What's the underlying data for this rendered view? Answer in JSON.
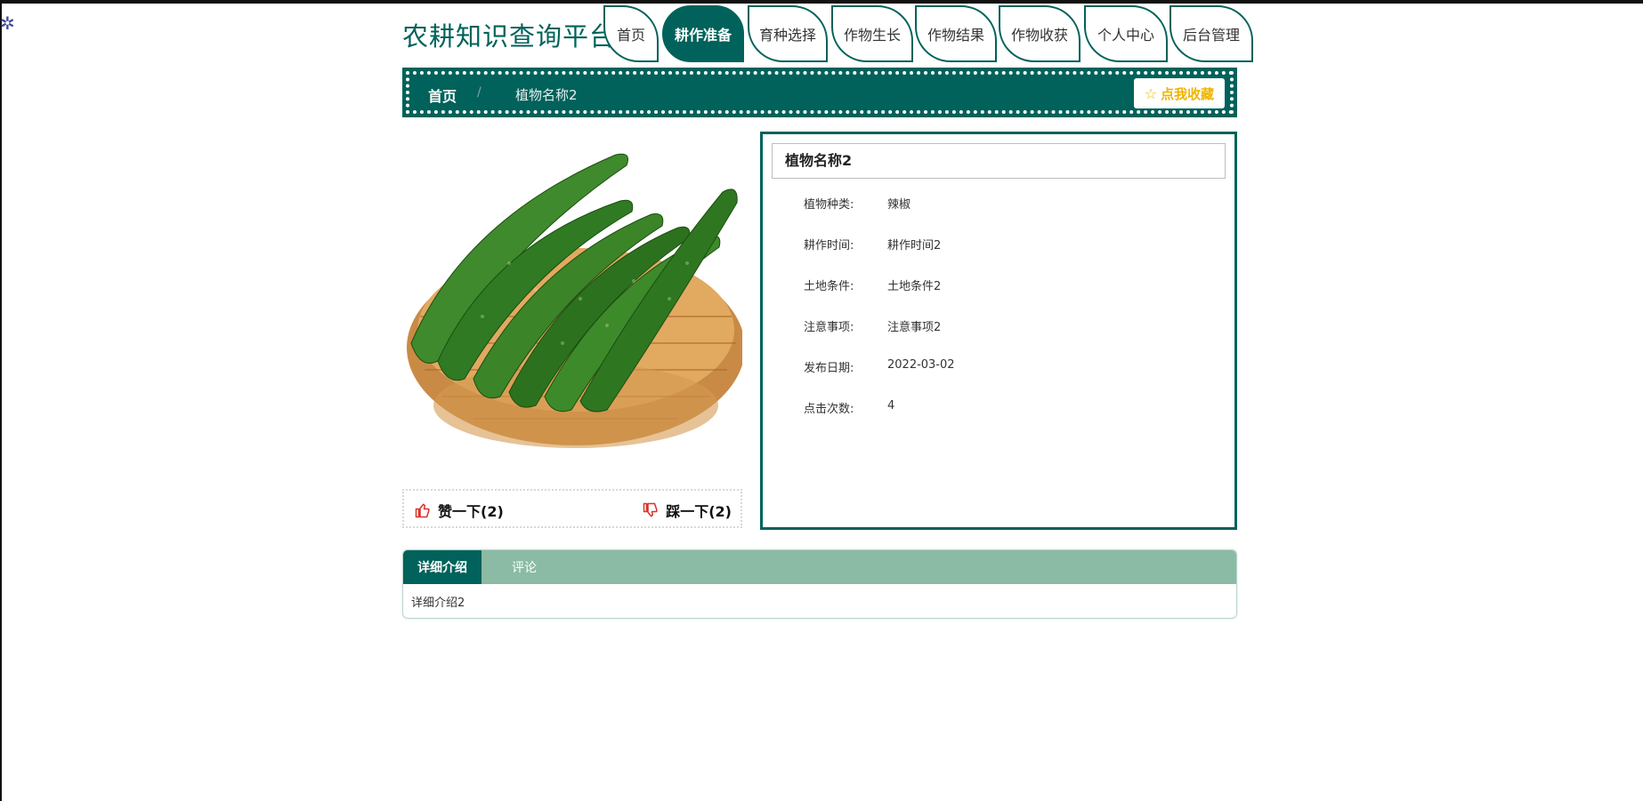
{
  "header": {
    "site_title": "农耕知识查询平台",
    "nav": [
      {
        "label": "首页",
        "active": false
      },
      {
        "label": "耕作准备",
        "active": true
      },
      {
        "label": "育种选择",
        "active": false
      },
      {
        "label": "作物生长",
        "active": false
      },
      {
        "label": "作物结果",
        "active": false
      },
      {
        "label": "作物收获",
        "active": false
      },
      {
        "label": "个人中心",
        "active": false
      },
      {
        "label": "后台管理",
        "active": false
      }
    ]
  },
  "breadcrumb": {
    "home": "首页",
    "separator": "/",
    "current": "植物名称2",
    "favorite_label": "点我收藏",
    "favorite_icon": "star-outline-icon"
  },
  "votes": {
    "like_label": "赞一下(2)",
    "dislike_label": "踩一下(2)",
    "like_icon": "thumbs-up-icon",
    "dislike_icon": "thumbs-down-icon"
  },
  "detail": {
    "title": "植物名称2",
    "fields": [
      {
        "label": "植物种类:",
        "value": "辣椒"
      },
      {
        "label": "耕作时间:",
        "value": "耕作时间2"
      },
      {
        "label": "土地条件:",
        "value": "土地条件2"
      },
      {
        "label": "注意事项:",
        "value": "注意事项2"
      },
      {
        "label": "发布日期:",
        "value": "2022-03-02"
      },
      {
        "label": "点击次数:",
        "value": "4"
      }
    ]
  },
  "tabs": {
    "items": [
      {
        "label": "详细介绍",
        "active": true
      },
      {
        "label": "评论",
        "active": false
      }
    ],
    "content": "详细介绍2"
  },
  "colors": {
    "primary": "#00625a",
    "tab_bar": "#8bbba4",
    "favorite": "#f0b400",
    "vote_icon": "#d9322b"
  }
}
